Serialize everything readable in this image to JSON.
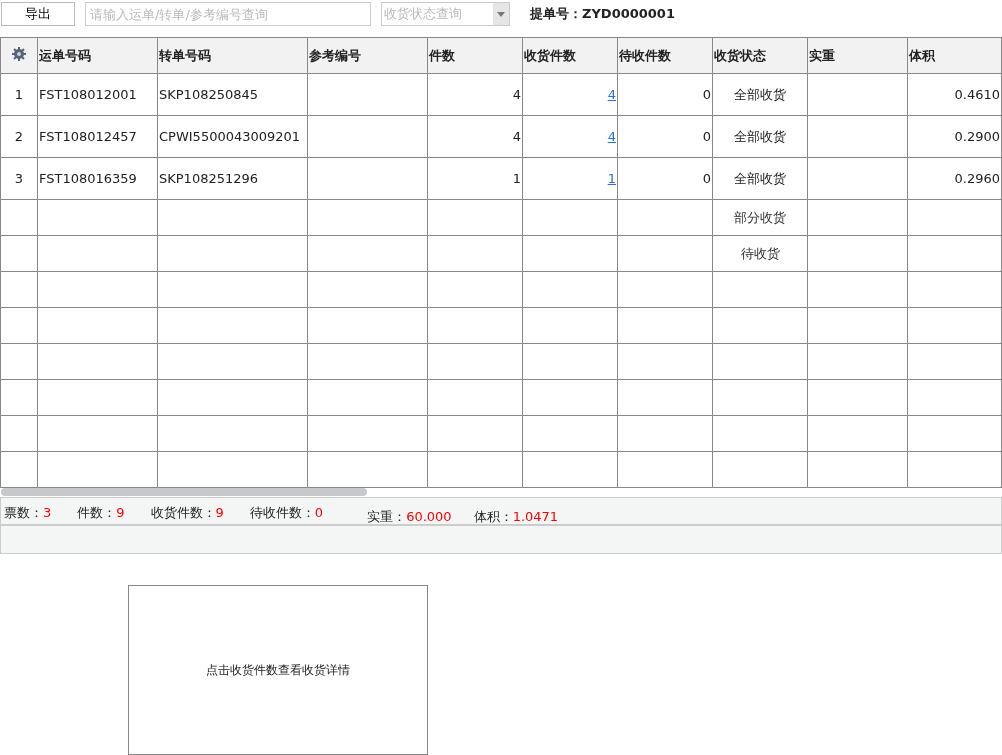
{
  "toolbar": {
    "export_button": "导出",
    "search": {
      "placeholder": "请输入运单/转单/参考编号查询"
    },
    "status_select": {
      "placeholder": "收货状态查询"
    },
    "bill_label": "提单号：",
    "bill_no": "ZYD0000001"
  },
  "table": {
    "columns": [
      "运单号码",
      "转单号码",
      "参考编号",
      "件数",
      "收货件数",
      "待收件数",
      "收货状态",
      "实重",
      "体积"
    ],
    "rows": [
      {
        "index": "1",
        "waybill": "FST108012001",
        "transfer": "SKP108250845",
        "pieces": "4",
        "received": "4",
        "pending": "0",
        "status": "全部收货",
        "volume": "0.4610"
      },
      {
        "index": "2",
        "waybill": "FST108012457",
        "transfer": "CPWI5500043009201",
        "pieces": "4",
        "received": "4",
        "pending": "0",
        "status": "全部收货",
        "volume": "0.2900"
      },
      {
        "index": "3",
        "waybill": "FST108016359",
        "transfer": "SKP108251296",
        "pieces": "1",
        "received": "1",
        "pending": "0",
        "status": "全部收货",
        "volume": "0.2960"
      }
    ],
    "status_options": [
      "部分收货",
      "待收货"
    ]
  },
  "summary": [
    {
      "label": "票数：",
      "value": "3"
    },
    {
      "label": "件数：",
      "value": "9"
    },
    {
      "label": "收货件数：",
      "value": "9"
    },
    {
      "label": "待收件数：",
      "value": "0"
    },
    {
      "label": "实重：",
      "value": "60.000"
    },
    {
      "label": "体积：",
      "value": "1.0471"
    }
  ],
  "hint": "点击收货件数查看收货详情"
}
